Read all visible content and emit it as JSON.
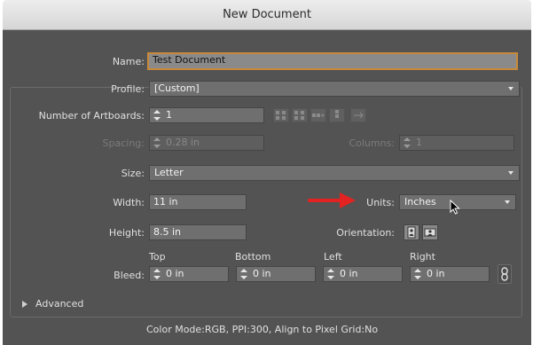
{
  "window": {
    "title": "New Document"
  },
  "fields": {
    "name": {
      "label": "Name:",
      "value": "Test Document"
    },
    "profile": {
      "label": "Profile:",
      "value": "[Custom]"
    },
    "artboards": {
      "label": "Number of Artboards:",
      "value": "1"
    },
    "spacing": {
      "label": "Spacing:",
      "value": "0.28 in"
    },
    "columns": {
      "label": "Columns:",
      "value": "1"
    },
    "size": {
      "label": "Size:",
      "value": "Letter"
    },
    "width": {
      "label": "Width:",
      "value": "11 in"
    },
    "units": {
      "label": "Units:",
      "value": "Inches"
    },
    "height": {
      "label": "Height:",
      "value": "8.5 in"
    },
    "orientation": {
      "label": "Orientation:"
    }
  },
  "bleed": {
    "label": "Bleed:",
    "top": {
      "label": "Top",
      "value": "0 in"
    },
    "bottom": {
      "label": "Bottom",
      "value": "0 in"
    },
    "left": {
      "label": "Left",
      "value": "0 in"
    },
    "right": {
      "label": "Right",
      "value": "0 in"
    }
  },
  "advanced": {
    "label": "Advanced"
  },
  "footer": {
    "summary": "Color Mode:RGB, PPI:300, Align to Pixel Grid:No"
  },
  "icons": {
    "annotation_arrow": "red-arrow-icon",
    "cursor": "mouse-cursor-icon",
    "portrait": "portrait-orientation-icon",
    "landscape": "landscape-orientation-icon",
    "link": "chain-link-icon"
  },
  "colors": {
    "dialog_bg": "#535353",
    "focus_ring": "#c88a3a",
    "annotation_arrow": "#e32222"
  }
}
